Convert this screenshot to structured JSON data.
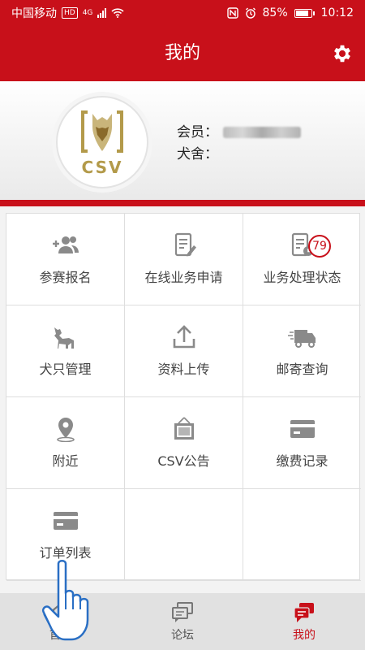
{
  "statusbar": {
    "carrier": "中国移动",
    "hd": "HD",
    "network": "4G",
    "battery": "85%",
    "time": "10:12"
  },
  "appbar": {
    "title": "我的"
  },
  "profile": {
    "logo_text": "CSV",
    "member_label": "会员：",
    "kennel_label": "犬舍："
  },
  "grid": {
    "items": [
      {
        "label": "参赛报名",
        "icon": "add-user-icon"
      },
      {
        "label": "在线业务申请",
        "icon": "edit-document-icon"
      },
      {
        "label": "业务处理状态",
        "icon": "document-clock-icon",
        "badge": "79"
      },
      {
        "label": "犬只管理",
        "icon": "dog-icon"
      },
      {
        "label": "资料上传",
        "icon": "upload-icon"
      },
      {
        "label": "邮寄查询",
        "icon": "delivery-truck-icon"
      },
      {
        "label": "附近",
        "icon": "location-pin-icon"
      },
      {
        "label": "CSV公告",
        "icon": "notice-board-icon"
      },
      {
        "label": "缴费记录",
        "icon": "card-icon"
      },
      {
        "label": "订单列表",
        "icon": "card-icon"
      }
    ]
  },
  "tabbar": {
    "items": [
      {
        "label": "首页",
        "icon": "home-icon"
      },
      {
        "label": "论坛",
        "icon": "chat-icon"
      },
      {
        "label": "我的",
        "icon": "chat-icon",
        "active": true
      }
    ]
  },
  "colors": {
    "brand": "#c8101a",
    "icon": "#8a8a8a",
    "gold": "#b39a4a"
  }
}
